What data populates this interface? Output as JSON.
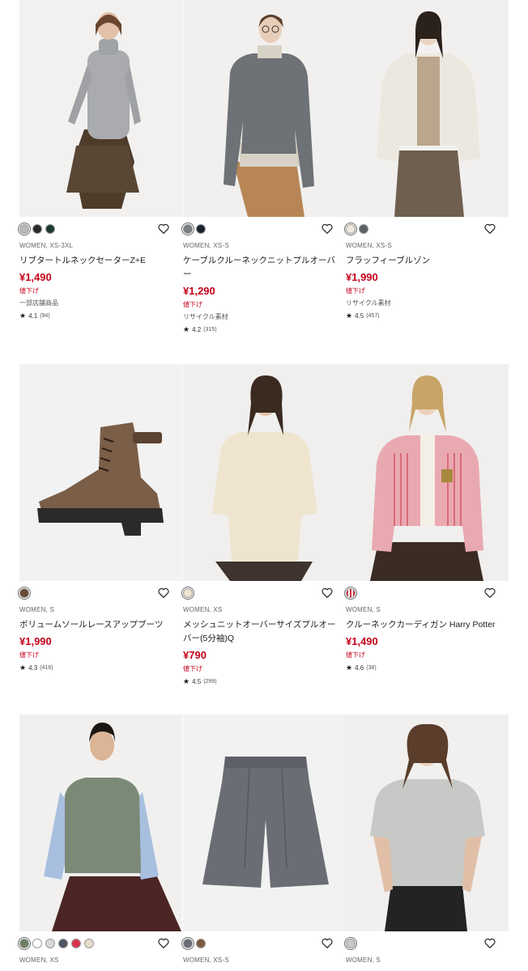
{
  "products": [
    {
      "image": "model-gray-turtleneck",
      "swatches": [
        "#b9b9b9",
        "#2a2a2a",
        "#1f3b2e"
      ],
      "meta": "WOMEN, XS-3XL",
      "name": "リブタートルネックセーターZ+E",
      "price": "¥1,490",
      "tag": "値下げ",
      "note": "一部店舗商品",
      "rating": "4.1",
      "count": "(94)"
    },
    {
      "image": "model-cable-knit",
      "swatches": [
        "#7a7d82",
        "#1d2230"
      ],
      "meta": "WOMEN, XS-S",
      "name": "ケーブルクルーネックニットプルオーバー",
      "price": "¥1,290",
      "tag": "値下げ",
      "note": "リサイクル素材",
      "rating": "4.2",
      "count": "(315)"
    },
    {
      "image": "model-fluffy-blouson",
      "swatches": [
        "#efe9dc",
        "#5c6168"
      ],
      "meta": "WOMEN, XS-S",
      "name": "フラッフィーブルゾン",
      "price": "¥1,990",
      "tag": "値下げ",
      "note": "リサイクル素材",
      "rating": "4.5",
      "count": "(457)"
    },
    {
      "image": "lace-up-boots",
      "swatches": [
        "#6a4a36"
      ],
      "meta": "WOMEN, S",
      "name": "ボリュームソールレースアップブーツ",
      "price": "¥1,990",
      "tag": "値下げ",
      "note": "",
      "rating": "4.3",
      "count": "(416)"
    },
    {
      "image": "model-mesh-pullover",
      "swatches": [
        "#efe6d1"
      ],
      "meta": "WOMEN, XS",
      "name": "メッシュニットオーバーサイズプルオーバー(5分袖)Q",
      "price": "¥790",
      "tag": "値下げ",
      "note": "",
      "rating": "4.5",
      "count": "(299)"
    },
    {
      "image": "model-cardigan-harry-potter",
      "swatches": [
        "#c8303f"
      ],
      "meta": "WOMEN, S",
      "name": "クルーネックカーディガン Harry Potter",
      "price": "¥1,490",
      "tag": "値下げ",
      "note": "",
      "rating": "4.6",
      "count": "(38)"
    },
    {
      "image": "model-green-vest",
      "swatches": [
        "#6f7f6a",
        "#ffffff",
        "#d9d9d9",
        "#4d5560",
        "#d6344d",
        "#e5dccd"
      ],
      "meta": "WOMEN, XS"
    },
    {
      "image": "gray-shorts",
      "swatches": [
        "#6a6e74",
        "#7d5a3f"
      ],
      "meta": "WOMEN, XS-S"
    },
    {
      "image": "model-gray-tee",
      "swatches": [
        "#c7c9c6"
      ],
      "meta": "WOMEN, S"
    }
  ]
}
